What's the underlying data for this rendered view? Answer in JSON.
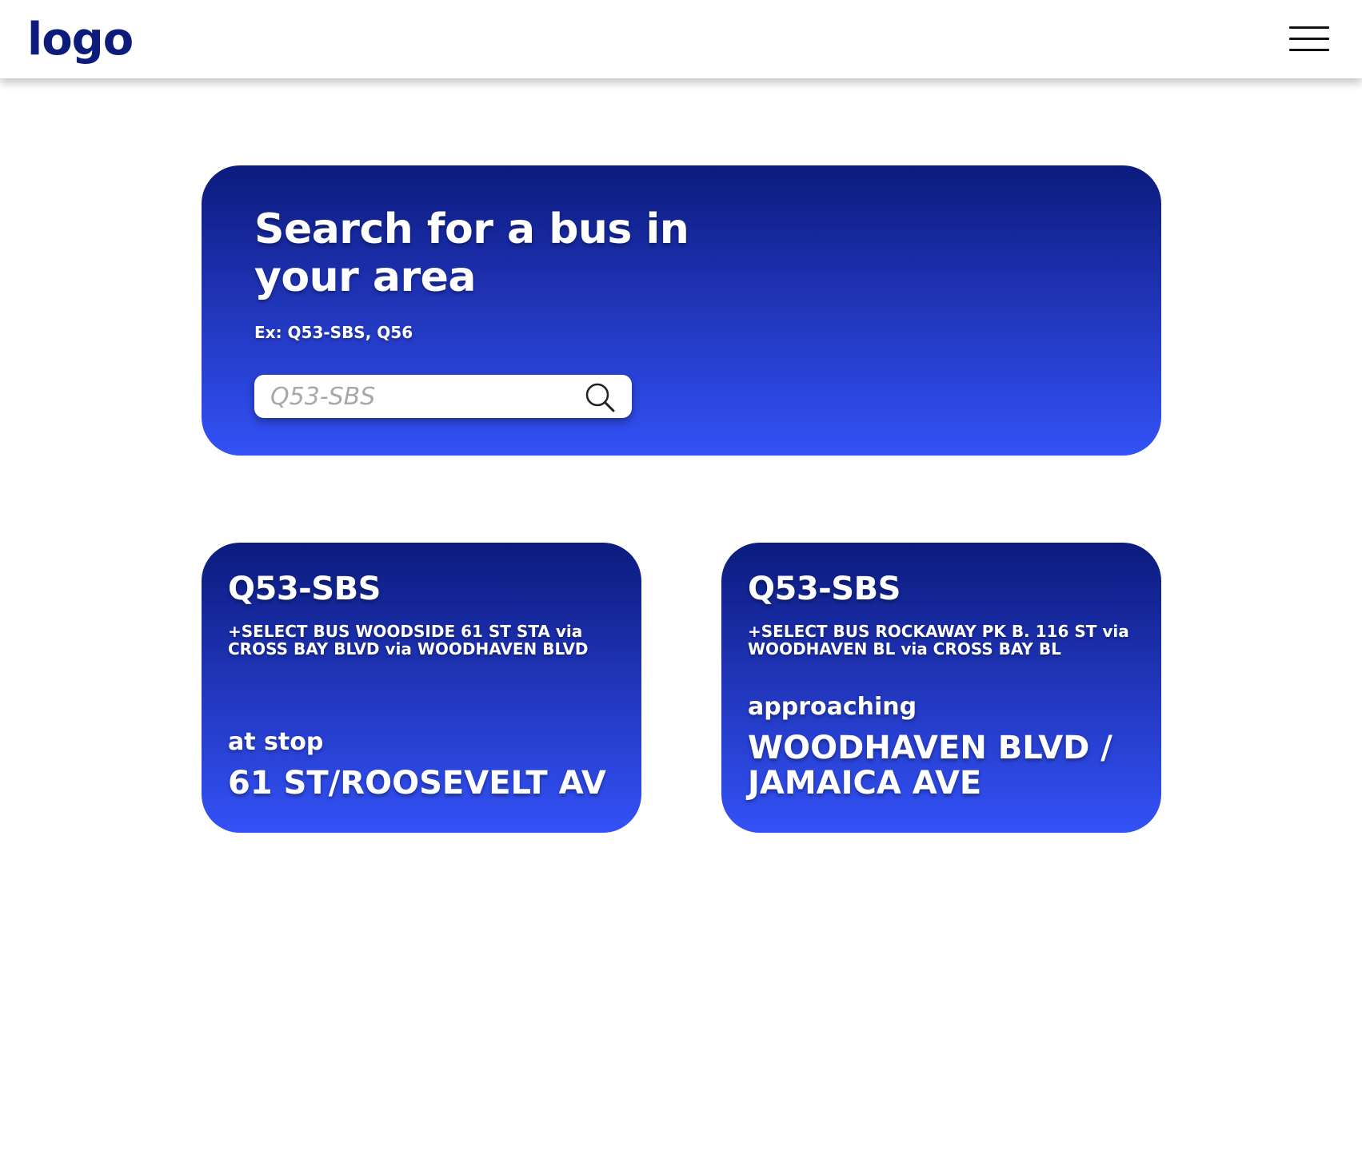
{
  "header": {
    "logo_text": "logo",
    "menu_icon": "hamburger-menu-icon"
  },
  "hero": {
    "title": "Search for a bus in your area",
    "example": "Ex: Q53-SBS, Q56",
    "search": {
      "placeholder": "Q53-SBS",
      "value": "",
      "icon": "search-icon"
    }
  },
  "results": [
    {
      "route": "Q53-SBS",
      "destination": "+SELECT BUS WOODSIDE 61 ST STA via CROSS BAY BLVD via WOODHAVEN BLVD",
      "status": "at stop",
      "stop": "61 ST/ROOSEVELT AV"
    },
    {
      "route": "Q53-SBS",
      "destination": "+SELECT BUS ROCKAWAY PK B. 116 ST via WOODHAVEN BL via CROSS BAY BL",
      "status": "approaching",
      "stop": "WOODHAVEN BLVD / JAMAICA AVE"
    }
  ],
  "colors": {
    "brand": "#0d1b7a",
    "gradient_top": "#0b1b7d",
    "gradient_bottom": "#3352f7",
    "text_on_brand": "#ffffff"
  }
}
